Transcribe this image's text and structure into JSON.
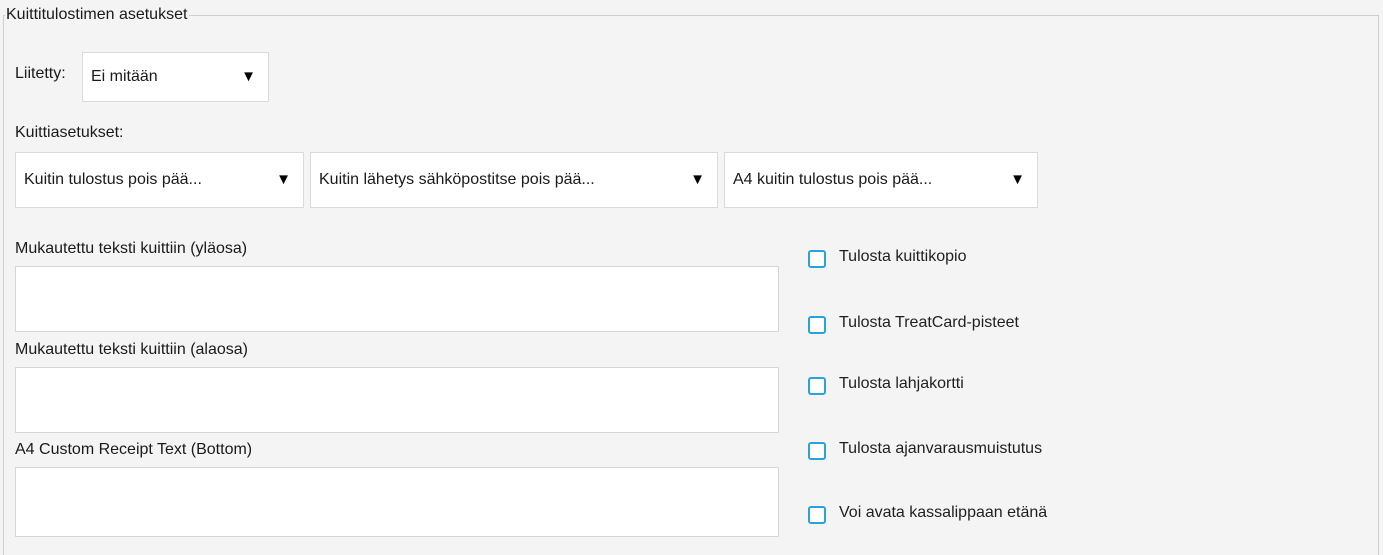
{
  "section": {
    "title": "Kuittitulostimen asetukset"
  },
  "connected": {
    "label": "Liitetty:",
    "value": "Ei mitään"
  },
  "receipt_settings": {
    "label": "Kuittiasetukset:",
    "print_select": "Kuitin tulostus pois pää...",
    "email_select": "Kuitin lähetys sähköpostitse pois pää...",
    "a4_select": "A4 kuitin tulostus pois pää..."
  },
  "custom_text": {
    "top_label": "Mukautettu teksti kuittiin (yläosa)",
    "top_value": "",
    "bottom_label": "Mukautettu teksti kuittiin (alaosa)",
    "bottom_value": "",
    "a4_bottom_label": "A4 Custom Receipt Text (Bottom)",
    "a4_bottom_value": ""
  },
  "checkboxes": [
    {
      "label": "Tulosta kuittikopio",
      "checked": false
    },
    {
      "label": "Tulosta TreatCard-pisteet",
      "checked": false
    },
    {
      "label": "Tulosta lahjakortti",
      "checked": false
    },
    {
      "label": "Tulosta ajanvarausmuistutus",
      "checked": false
    },
    {
      "label": "Voi avata kassalippaan etänä",
      "checked": false
    }
  ],
  "icons": {
    "dropdown": "chevron-down-icon",
    "checkbox": "checkbox-unchecked-icon"
  },
  "colors": {
    "background": "#f4f4f4",
    "checkbox_accent": "#29a3dc"
  }
}
